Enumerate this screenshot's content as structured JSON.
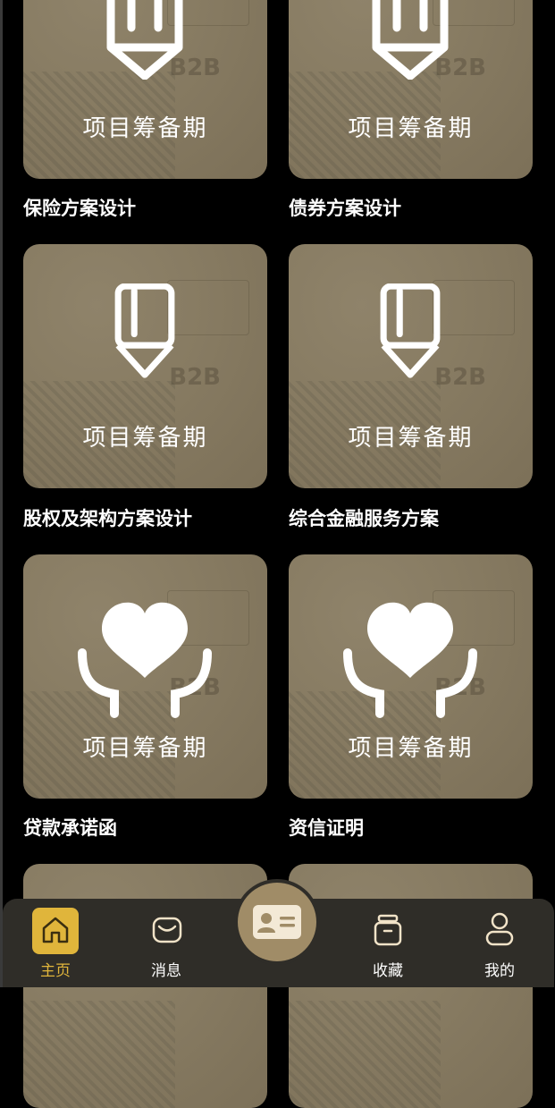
{
  "cards": [
    {
      "badge": "项目筹备期",
      "title": "保险方案设计",
      "icon": "pencil-icon"
    },
    {
      "badge": "项目筹备期",
      "title": "债券方案设计",
      "icon": "pencil-icon"
    },
    {
      "badge": "项目筹备期",
      "title": "股权及架构方案设计",
      "icon": "pencil-icon"
    },
    {
      "badge": "项目筹备期",
      "title": "综合金融服务方案",
      "icon": "pencil-icon"
    },
    {
      "badge": "项目筹备期",
      "title": "贷款承诺函",
      "icon": "heart-hands-icon"
    },
    {
      "badge": "项目筹备期",
      "title": "资信证明",
      "icon": "heart-hands-icon"
    }
  ],
  "watermark": "B2B",
  "tabbar": {
    "home": "主页",
    "messages": "消息",
    "favorites": "收藏",
    "mine": "我的",
    "center_icon": "id-card-icon"
  },
  "colors": {
    "accent": "#e0b53b",
    "card": "#877b62",
    "tabbar": "#2f2d28",
    "background": "#000000"
  }
}
